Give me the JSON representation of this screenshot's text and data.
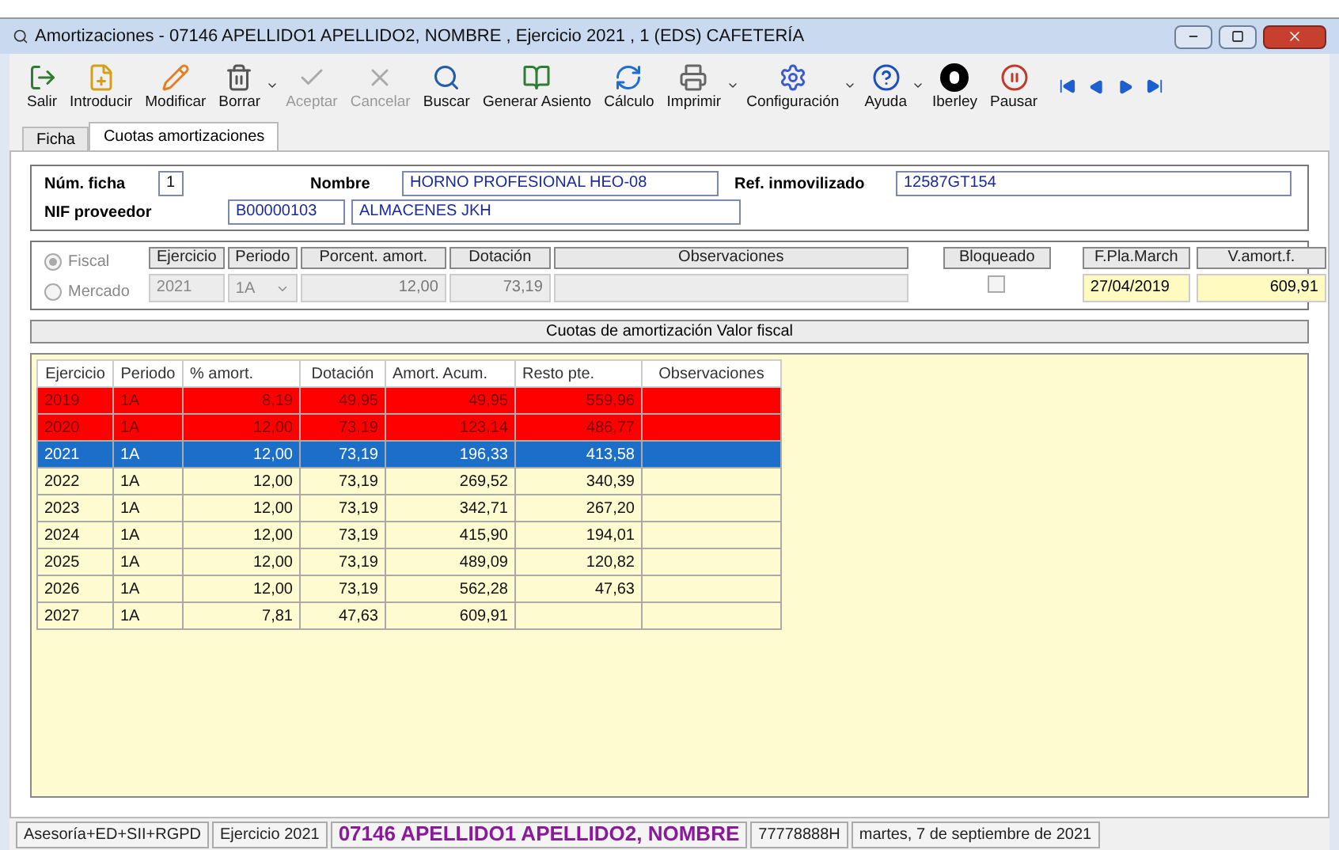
{
  "window": {
    "title": "Amortizaciones - 07146 APELLIDO1 APELLIDO2, NOMBRE , Ejercicio 2021 , 1  (EDS) CAFETERÍA"
  },
  "toolbar": [
    {
      "kind": "exit",
      "label": "Salir",
      "disabled": false,
      "dropdown": false
    },
    {
      "kind": "add",
      "label": "Introducir",
      "disabled": false,
      "dropdown": false
    },
    {
      "kind": "edit",
      "label": "Modificar",
      "disabled": false,
      "dropdown": false
    },
    {
      "kind": "delete",
      "label": "Borrar",
      "disabled": false,
      "dropdown": true
    },
    {
      "kind": "accept",
      "label": "Aceptar",
      "disabled": true,
      "dropdown": false
    },
    {
      "kind": "cancel",
      "label": "Cancelar",
      "disabled": true,
      "dropdown": false
    },
    {
      "kind": "search",
      "label": "Buscar",
      "disabled": false,
      "dropdown": false
    },
    {
      "kind": "entry",
      "label": "Generar Asiento",
      "disabled": false,
      "dropdown": false
    },
    {
      "kind": "calc",
      "label": "Cálculo",
      "disabled": false,
      "dropdown": false
    },
    {
      "kind": "print",
      "label": "Imprimir",
      "disabled": false,
      "dropdown": true
    },
    {
      "kind": "config",
      "label": "Configuración",
      "disabled": false,
      "dropdown": true
    },
    {
      "kind": "help",
      "label": "Ayuda",
      "disabled": false,
      "dropdown": true
    },
    {
      "kind": "brand",
      "label": "Iberley",
      "disabled": false,
      "dropdown": false
    },
    {
      "kind": "pause",
      "label": "Pausar",
      "disabled": false,
      "dropdown": false
    }
  ],
  "tabs": [
    {
      "label": "Ficha",
      "selected": false
    },
    {
      "label": "Cuotas amortizaciones",
      "selected": true
    }
  ],
  "header": {
    "num_ficha_label": "Núm. ficha",
    "num_ficha": "1",
    "nombre_label": "Nombre",
    "nombre": "HORNO PROFESIONAL HEO-08",
    "ref_label": "Ref. inmovilizado",
    "ref": "12587GT154",
    "nif_label": "NIF proveedor",
    "nif": "B00000103",
    "proveedor": "ALMACENES JKH"
  },
  "valuation": [
    {
      "label": "Fiscal",
      "selected": true
    },
    {
      "label": "Mercado",
      "selected": false
    }
  ],
  "detail": {
    "ejercicio_label": "Ejercicio",
    "ejercicio": "2021",
    "periodo_label": "Periodo",
    "periodo": "1A",
    "porcent_label": "Porcent. amort.",
    "porcent": "12,00",
    "dotacion_label": "Dotación",
    "dotacion": "73,19",
    "observaciones_label": "Observaciones",
    "bloqueado_label": "Bloqueado",
    "bloqueado": false,
    "fpla_label": "F.Pla.March",
    "fpla": "27/04/2019",
    "vamort_label": "V.amort.f.",
    "vamort": "609,91"
  },
  "table": {
    "title": "Cuotas de amortización Valor fiscal",
    "columns": [
      "Ejercicio",
      "Periodo",
      "% amort.",
      "Dotación",
      "Amort. Acum.",
      "Resto pte.",
      "Observaciones"
    ],
    "rows": [
      {
        "kind": "closed",
        "selected": false,
        "cells": [
          "2019",
          "1A",
          "8,19",
          "49,95",
          "49,95",
          "559,96",
          ""
        ]
      },
      {
        "kind": "closed",
        "selected": false,
        "cells": [
          "2020",
          "1A",
          "12,00",
          "73,19",
          "123,14",
          "486,77",
          ""
        ]
      },
      {
        "kind": "open",
        "selected": true,
        "cells": [
          "2021",
          "1A",
          "12,00",
          "73,19",
          "196,33",
          "413,58",
          ""
        ]
      },
      {
        "kind": "open",
        "selected": false,
        "cells": [
          "2022",
          "1A",
          "12,00",
          "73,19",
          "269,52",
          "340,39",
          ""
        ]
      },
      {
        "kind": "open",
        "selected": false,
        "cells": [
          "2023",
          "1A",
          "12,00",
          "73,19",
          "342,71",
          "267,20",
          ""
        ]
      },
      {
        "kind": "open",
        "selected": false,
        "cells": [
          "2024",
          "1A",
          "12,00",
          "73,19",
          "415,90",
          "194,01",
          ""
        ]
      },
      {
        "kind": "open",
        "selected": false,
        "cells": [
          "2025",
          "1A",
          "12,00",
          "73,19",
          "489,09",
          "120,82",
          ""
        ]
      },
      {
        "kind": "open",
        "selected": false,
        "cells": [
          "2026",
          "1A",
          "12,00",
          "73,19",
          "562,28",
          "47,63",
          ""
        ]
      },
      {
        "kind": "open",
        "selected": false,
        "cells": [
          "2027",
          "1A",
          "7,81",
          "47,63",
          "609,91",
          "",
          ""
        ]
      }
    ]
  },
  "status_bar": [
    "Asesoría+ED+SII+RGPD",
    "Ejercicio 2021",
    "07146 APELLIDO1 APELLIDO2, NOMBRE",
    "77778888H",
    "martes, 7 de septiembre de 2021"
  ]
}
